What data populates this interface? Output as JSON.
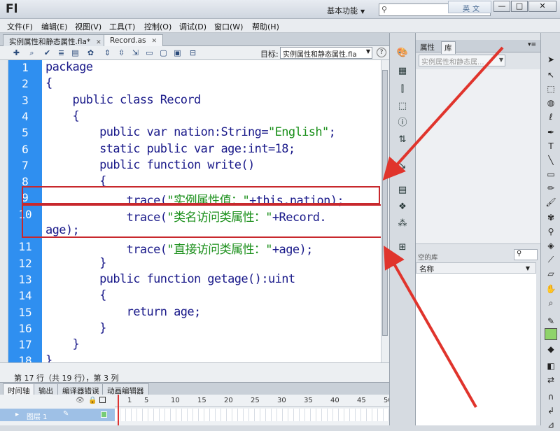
{
  "app": {
    "logo": "Fl",
    "workspace": "基本功能",
    "ime_label": "英文",
    "window_buttons": [
      "—",
      "□",
      "✕"
    ]
  },
  "menu": [
    "文件(F)",
    "编辑(E)",
    "视图(V)",
    "工具(T)",
    "控制(O)",
    "调试(D)",
    "窗口(W)",
    "帮助(H)"
  ],
  "doc_tabs": [
    {
      "label": "实例属性和静态属性.fla*",
      "active": false
    },
    {
      "label": "Record.as",
      "active": true
    }
  ],
  "script_toolbar": {
    "target_label": "目标:",
    "target_value": "实例属性和静态属性.fla",
    "help": "?"
  },
  "code": {
    "lines": [
      {
        "n": "1",
        "text": "package"
      },
      {
        "n": "2",
        "text": "{"
      },
      {
        "n": "3",
        "text": "    public class Record"
      },
      {
        "n": "4",
        "text": "    {"
      },
      {
        "n": "5",
        "pre": "        public var nation:String=",
        "str": "\"English\"",
        "post": ";"
      },
      {
        "n": "6",
        "text": "        static public var age:int=18;"
      },
      {
        "n": "7",
        "text": "        public function write()"
      },
      {
        "n": "8",
        "text": "        {"
      },
      {
        "n": "9",
        "pre": "            trace(",
        "str": "\"实例属性值：\"",
        "post": "+this.nation);"
      },
      {
        "n": "10",
        "pre": "            trace(",
        "str": "\"类名访问类属性：\"",
        "post": "+Record."
      },
      {
        "n": "",
        "text": "age);"
      },
      {
        "n": "11",
        "pre": "            trace(",
        "str": "\"直接访问类属性：\"",
        "post": "+age);"
      },
      {
        "n": "12",
        "text": "        }"
      },
      {
        "n": "13",
        "text": "        public function getage():uint"
      },
      {
        "n": "14",
        "text": "        {"
      },
      {
        "n": "15",
        "text": "            return age;"
      },
      {
        "n": "16",
        "text": "        }"
      },
      {
        "n": "17",
        "text": "    }"
      },
      {
        "n": "18",
        "text": "}"
      }
    ]
  },
  "status": "第 17 行（共 19 行），第 3 列",
  "timeline": {
    "tabs": [
      "时间轴",
      "输出",
      "编译器错误",
      "动画编辑器"
    ],
    "frame_numbers": [
      "1",
      "5",
      "10",
      "15",
      "20",
      "25",
      "30",
      "35",
      "40",
      "45",
      "50",
      "55"
    ],
    "layer": "图层 1"
  },
  "library": {
    "tabs": [
      "属性",
      "库"
    ],
    "document": "实例属性和静态属...",
    "empty": "空的库",
    "column": "名称"
  },
  "colors": {
    "gutter": "#2f8ff0",
    "keyword": "#1a1a8a",
    "string": "#1a8f1a",
    "highlight_box": "#c8282d",
    "arrow": "#e0342c"
  }
}
